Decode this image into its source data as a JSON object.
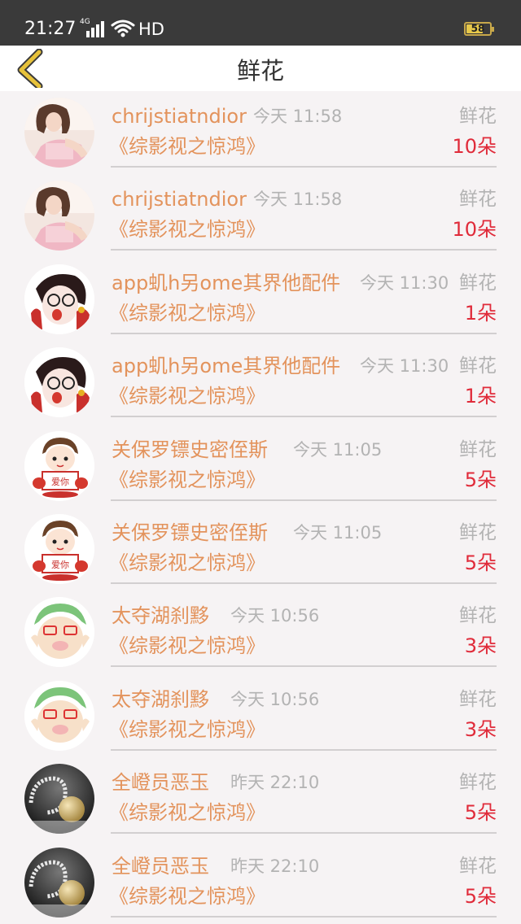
{
  "status_bar": {
    "time": "21:27",
    "network": "4G",
    "hd": "HD",
    "battery": "58"
  },
  "header": {
    "title": "鲜花"
  },
  "items": [
    {
      "name": "chrijstiatndior",
      "time": "今天 11:58",
      "label": "鲜花",
      "book": "《综影视之惊鸿》",
      "count": "10朵",
      "avatar": "girl-photo"
    },
    {
      "name": "chrijstiatndior",
      "time": "今天 11:58",
      "label": "鲜花",
      "book": "《综影视之惊鸿》",
      "count": "10朵",
      "avatar": "girl-photo"
    },
    {
      "name": "app虮h另ome其界他配件",
      "time": "今天 11:30",
      "label": "鲜花",
      "book": "《综影视之惊鸿》",
      "count": "1朵",
      "avatar": "cartoon-glasses"
    },
    {
      "name": "app虮h另ome其界他配件",
      "time": "今天 11:30",
      "label": "鲜花",
      "book": "《综影视之惊鸿》",
      "count": "1朵",
      "avatar": "cartoon-glasses"
    },
    {
      "name": "关保罗镖史密侄斯",
      "time": "今天 11:05",
      "label": "鲜花",
      "book": "《综影视之惊鸿》",
      "count": "5朵",
      "avatar": "cartoon-boy-sign"
    },
    {
      "name": "关保罗镖史密侄斯",
      "time": "今天 11:05",
      "label": "鲜花",
      "book": "《综影视之惊鸿》",
      "count": "5朵",
      "avatar": "cartoon-boy-sign"
    },
    {
      "name": "太夺湖刹黟",
      "time": "今天 10:56",
      "label": "鲜花",
      "book": "《综影视之惊鸿》",
      "count": "3朵",
      "avatar": "cartoon-green-hair"
    },
    {
      "name": "太夺湖刹黟",
      "time": "今天 10:56",
      "label": "鲜花",
      "book": "《综影视之惊鸿》",
      "count": "3朵",
      "avatar": "cartoon-green-hair"
    },
    {
      "name": "全嶝员恶玉",
      "time": "昨天 22:10",
      "label": "鲜花",
      "book": "《综影视之惊鸿》",
      "count": "5朵",
      "avatar": "pearl-earring"
    },
    {
      "name": "全嶝员恶玉",
      "time": "昨天 22:10",
      "label": "鲜花",
      "book": "《综影视之惊鸿》",
      "count": "5朵",
      "avatar": "pearl-earring"
    }
  ],
  "colors": {
    "accent_name": "#e3935c",
    "count": "#e02b3a",
    "muted": "#b3b3b3",
    "back_arrow": "#e7c23a"
  }
}
